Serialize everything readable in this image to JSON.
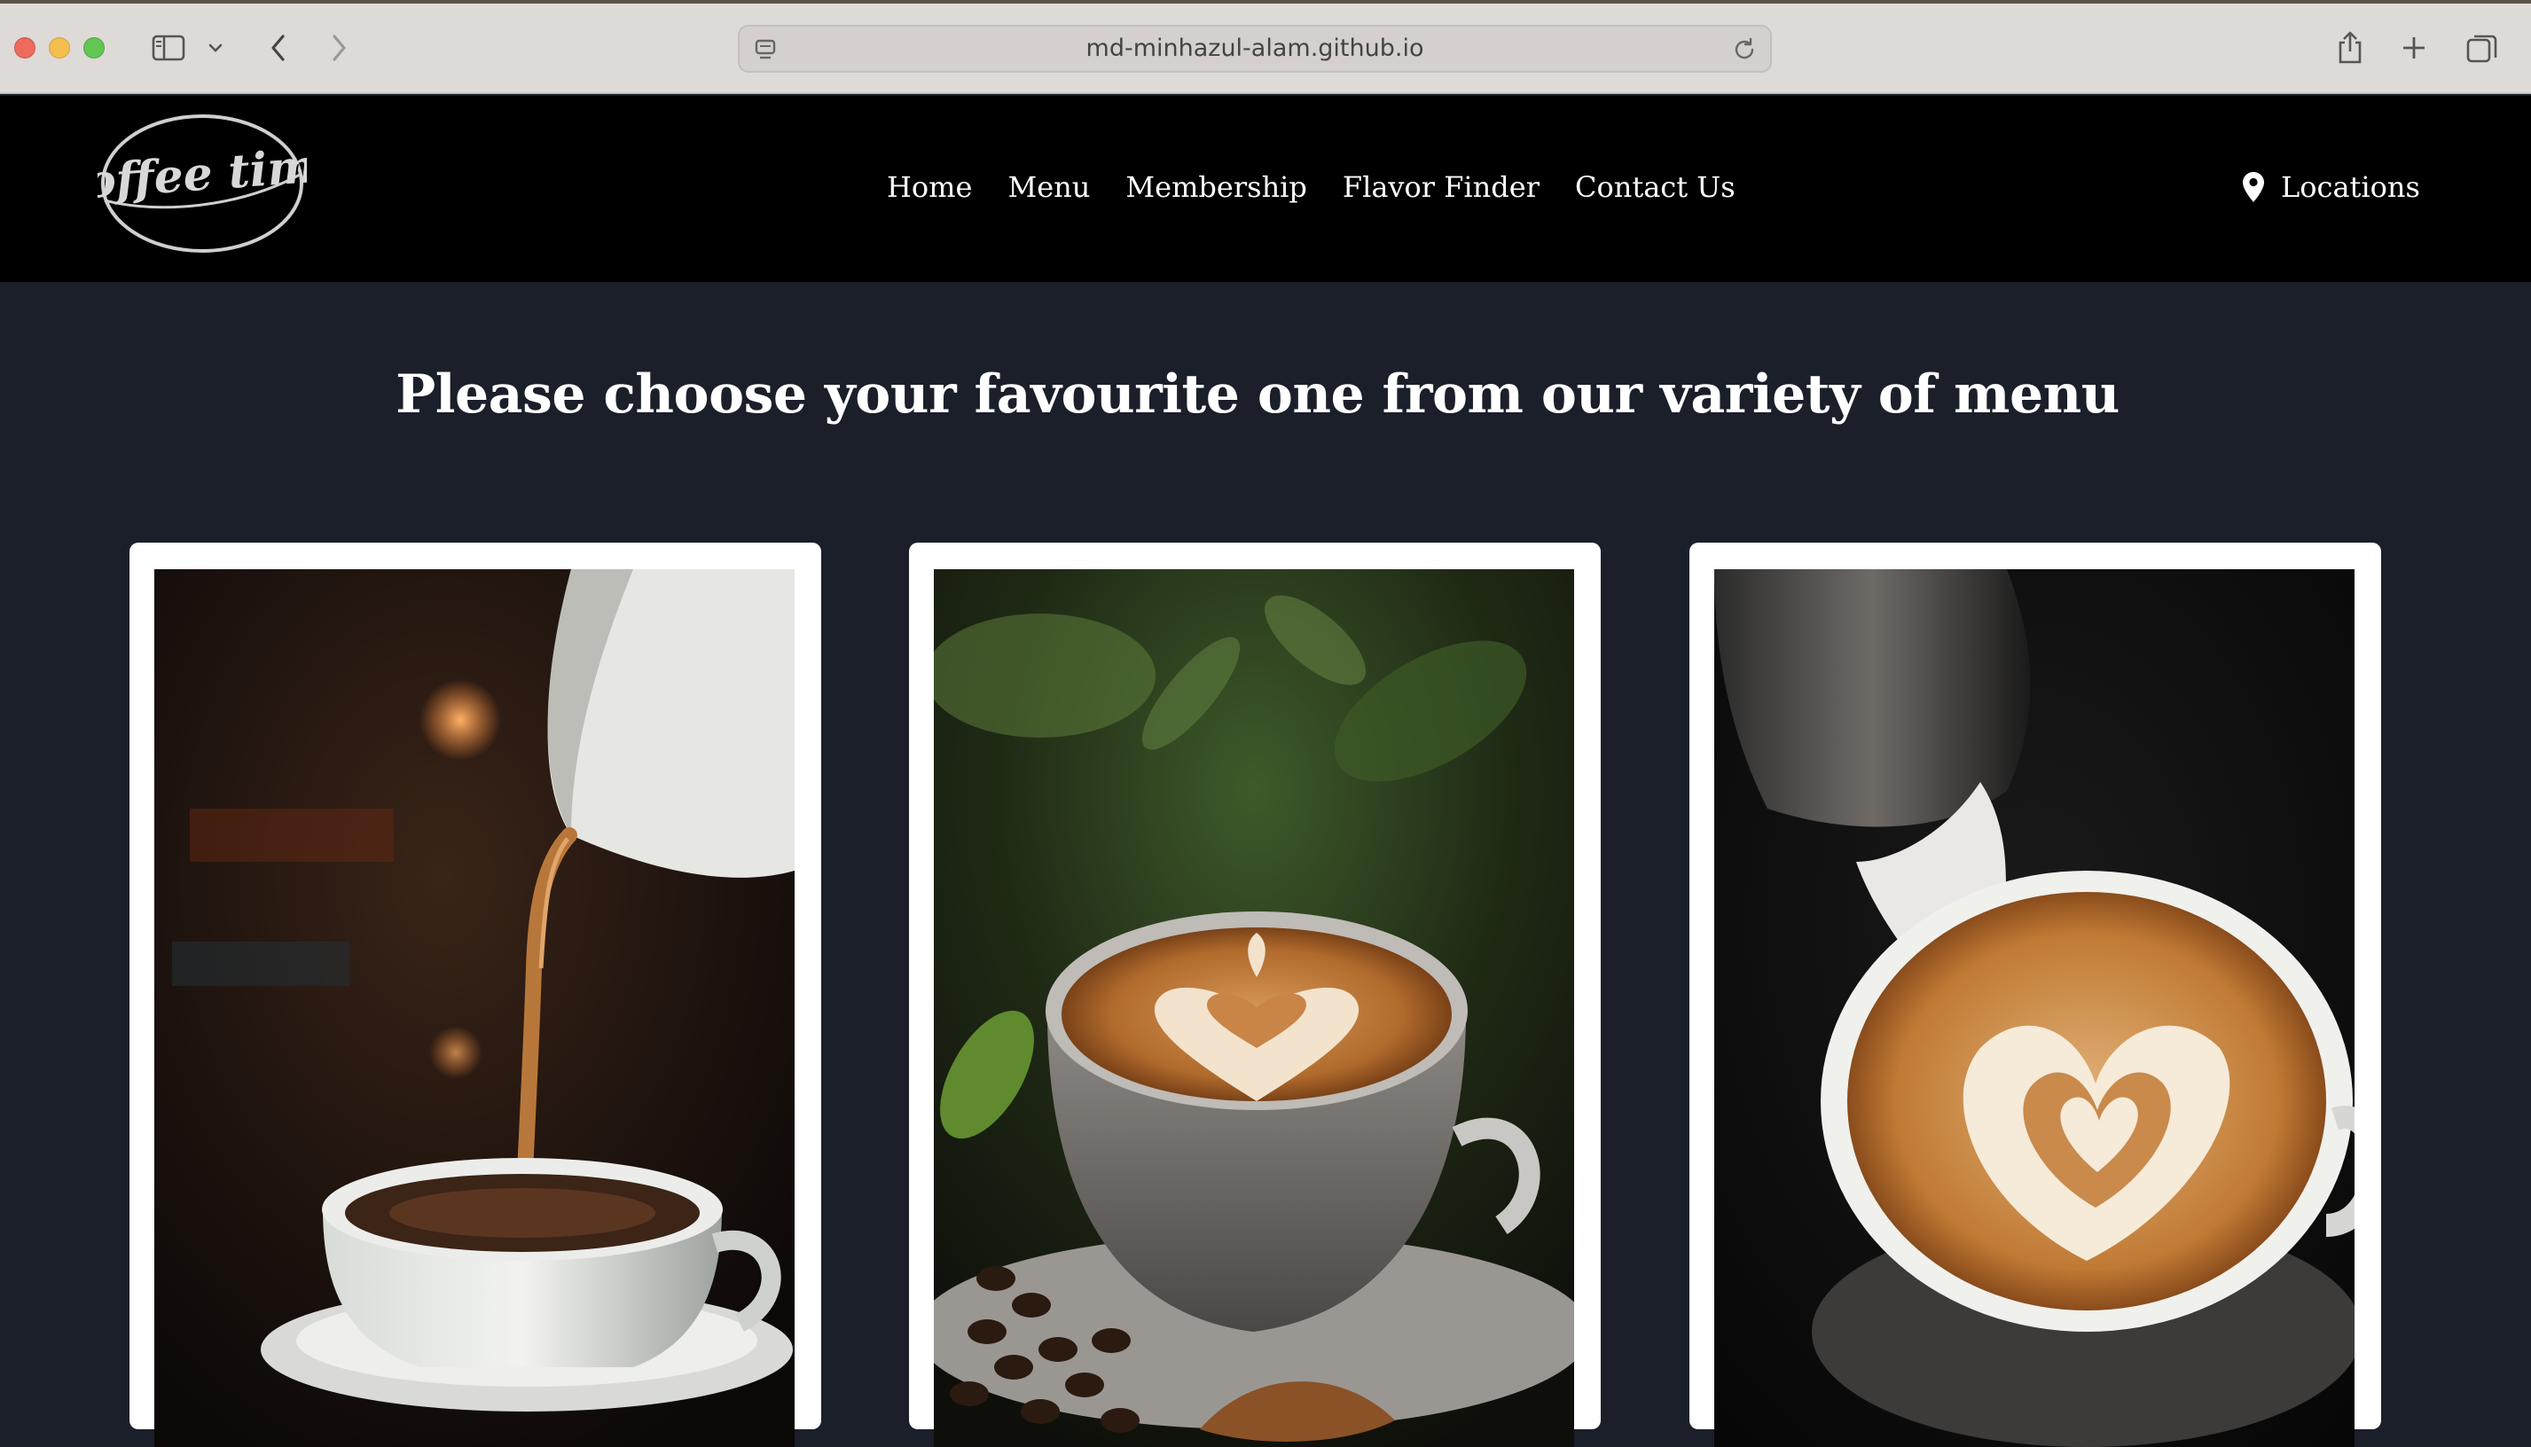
{
  "browser": {
    "url": "md-minhazul-alam.github.io"
  },
  "nav": {
    "logo_text": "coffee time",
    "links": [
      "Home",
      "Menu",
      "Membership",
      "Flavor Finder",
      "Contact Us"
    ],
    "locations_label": "Locations"
  },
  "main": {
    "heading": "Please choose your favourite one from our variety of menu"
  }
}
